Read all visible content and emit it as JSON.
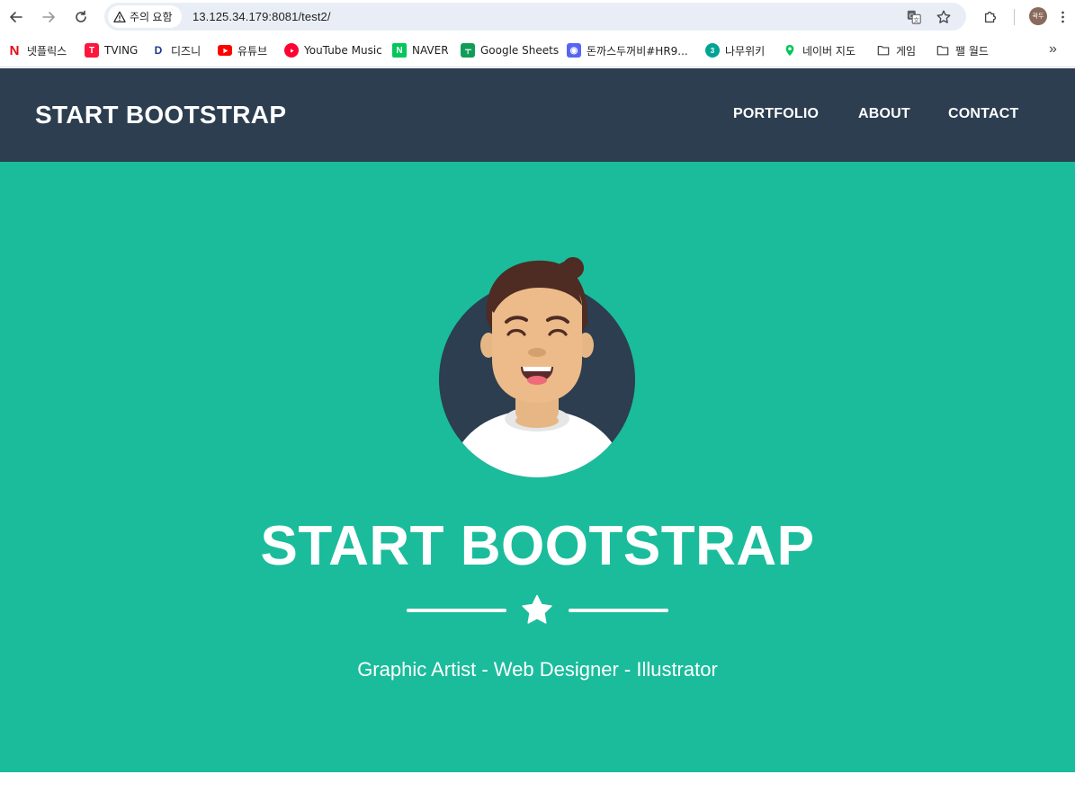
{
  "browser": {
    "security_label": "주의 요함",
    "url": "13.125.34.179:8081/test2/",
    "profile_initials": "곽두"
  },
  "bookmarks": [
    {
      "label": "넷플릭스",
      "icon": "netflix-icon",
      "color": "#e50914"
    },
    {
      "label": "TVING",
      "icon": "tving-icon",
      "color": "#ff153c"
    },
    {
      "label": "디즈니",
      "icon": "disney-icon",
      "color": "#1a3a8f"
    },
    {
      "label": "유튜브",
      "icon": "youtube-icon",
      "color": "#ff0000"
    },
    {
      "label": "YouTube Music",
      "icon": "youtube-music-icon",
      "color": "#ff0033"
    },
    {
      "label": "NAVER",
      "icon": "naver-icon",
      "color": "#03c75a"
    },
    {
      "label": "Google Sheets",
      "icon": "google-sheets-icon",
      "color": "#0f9d58"
    },
    {
      "label": "돈까스두꺼비#HR9...",
      "icon": "discord-icon",
      "color": "#5865f2"
    },
    {
      "label": "나무위키",
      "icon": "namuwiki-icon",
      "color": "#00a495"
    },
    {
      "label": "네이버 지도",
      "icon": "naver-map-icon",
      "color": "#03c75a"
    },
    {
      "label": "게임",
      "icon": "folder-icon",
      "color": "#444444"
    },
    {
      "label": "팰 월드",
      "icon": "folder-icon",
      "color": "#444444"
    }
  ],
  "site": {
    "brand": "START BOOTSTRAP",
    "nav": [
      "PORTFOLIO",
      "ABOUT",
      "CONTACT"
    ],
    "heading": "START BOOTSTRAP",
    "subheading": "Graphic Artist - Web Designer - Illustrator",
    "colors": {
      "navbar": "#2c3e50",
      "masthead": "#1abc9c",
      "text": "#ffffff"
    }
  }
}
